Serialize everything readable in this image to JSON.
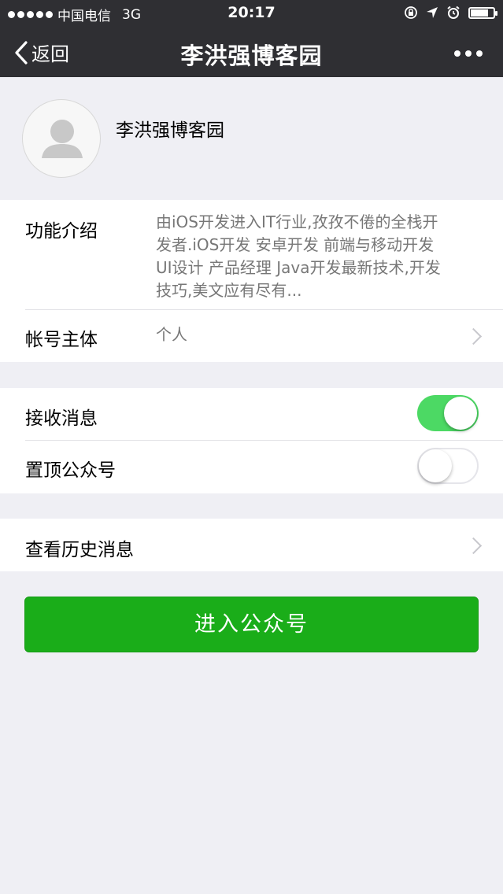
{
  "status_bar": {
    "carrier": "中国电信",
    "network": "3G",
    "time": "20:17",
    "signal_bars": 5,
    "battery_level": 0.85
  },
  "nav": {
    "back_label": "返回",
    "title": "李洪强博客园",
    "more_icon": "ellipsis-icon"
  },
  "profile": {
    "name": "李洪强博客园",
    "avatar_icon": "default-user-icon"
  },
  "info": {
    "intro_label": "功能介绍",
    "intro_text_lines": [
      "由iOS开发进入IT行业,孜孜不倦的全栈开",
      "发者.iOS开发 安卓开发 前端与移动开发",
      "UI设计 产品经理 Java开发最新技术,开发",
      "技巧,美文应有尽有..."
    ],
    "account_label": "帐号主体",
    "account_value": "个人"
  },
  "settings": {
    "receive_label": "接收消息",
    "receive_on": true,
    "pin_label": "置顶公众号",
    "pin_on": false
  },
  "history": {
    "label": "查看历史消息"
  },
  "enter_button": "进入公众号",
  "colors": {
    "nav_bg": "#2f2f33",
    "toggle_on": "#4cd964",
    "button_green": "#1aad19",
    "page_bg": "#efeff4"
  }
}
